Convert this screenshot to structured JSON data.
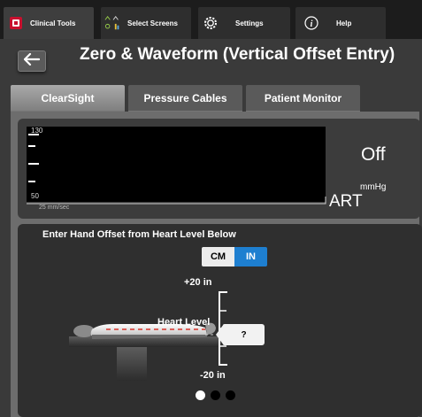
{
  "nav": {
    "tabs": [
      {
        "label": "Clinical Tools",
        "icon": "clinical-tools-icon",
        "active": true
      },
      {
        "label": "Select Screens",
        "icon": "select-screens-icon",
        "active": false
      },
      {
        "label": "Settings",
        "icon": "gear-icon",
        "active": false
      },
      {
        "label": "Help",
        "icon": "info-icon",
        "active": false
      }
    ]
  },
  "page": {
    "title": "Zero & Waveform (Vertical Offset Entry)",
    "back_icon": "back-arrow-icon"
  },
  "subtabs": [
    {
      "label": "ClearSight",
      "active": true
    },
    {
      "label": "Pressure Cables",
      "active": false
    },
    {
      "label": "Patient Monitor",
      "active": false
    }
  ],
  "waveform": {
    "scale_high": "130",
    "scale_low": "50",
    "sweep_speed": "25 mm/sec",
    "status": "Off",
    "unit": "mmHg",
    "channel": "ART"
  },
  "offset": {
    "instruction": "Enter Hand Offset from Heart Level Below",
    "unit_options": [
      "CM",
      "IN"
    ],
    "selected_unit": "IN",
    "scale_top": "+20 in",
    "scale_bottom": "-20 in",
    "heart_level_label": "Heart Level",
    "value_button": "?"
  },
  "pager": {
    "count": 3,
    "current": 1
  },
  "colors": {
    "accent_blue": "#1e7fd0",
    "heart_line": "#d9342b",
    "clinical_icon_red": "#c8102e"
  }
}
